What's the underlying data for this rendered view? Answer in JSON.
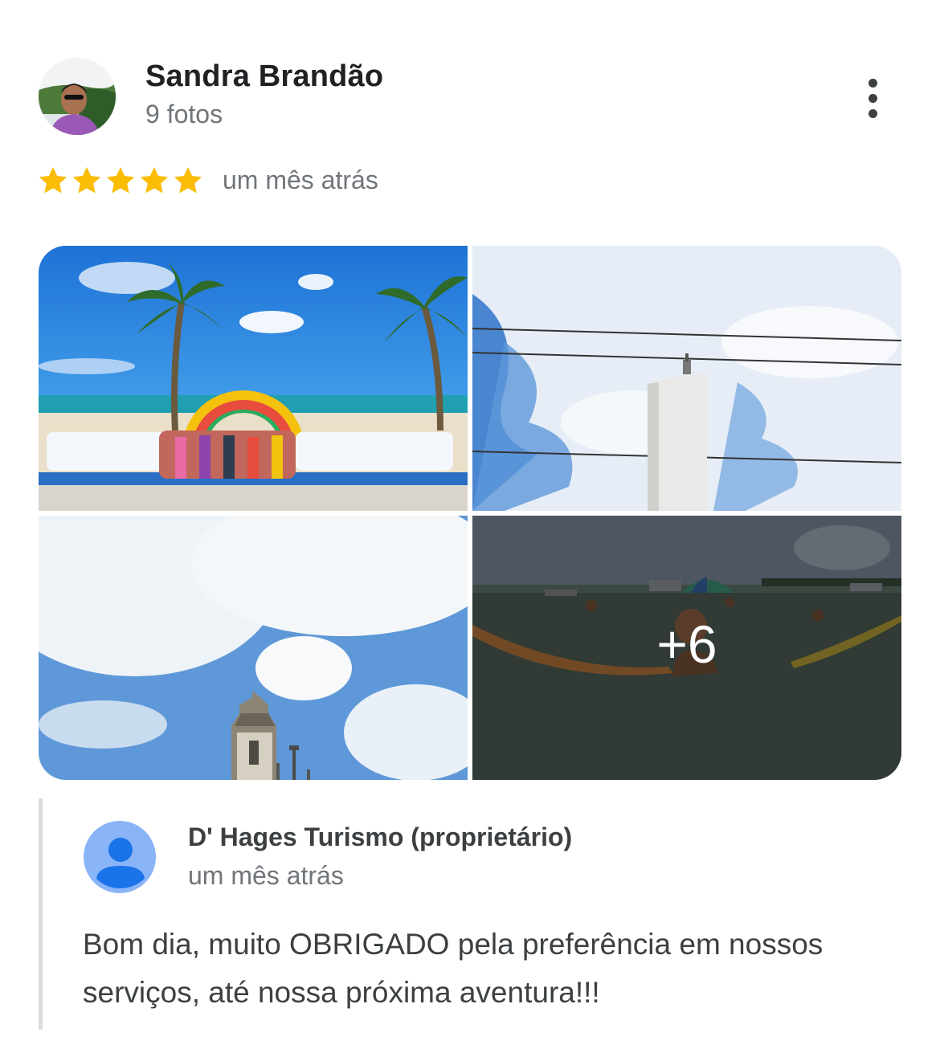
{
  "reviewer": {
    "name": "Sandra Brandão",
    "photo_count": "9 fotos",
    "avatar": "profile-photo"
  },
  "review": {
    "rating": 5,
    "max_rating": 5,
    "star_color": "#fbbc04",
    "time": "um mês atrás"
  },
  "menu": {
    "icon": "more-vertical-icon"
  },
  "photos": {
    "items": [
      {
        "name": "joao-pessoa-sign-beach-photo"
      },
      {
        "name": "lighthouse-sky-photo"
      },
      {
        "name": "church-tower-sky-photo"
      },
      {
        "name": "sea-hammock-photo"
      }
    ],
    "more_label": "+6"
  },
  "owner_reply": {
    "name": "D' Hages Turismo (proprietário)",
    "time": "um mês atrás",
    "avatar_icon": "person-icon",
    "avatar_color": "#8ab4f8",
    "text": "Bom dia, muito OBRIGADO pela preferência em nossos serviços, até nossa próxima aventura!!!"
  }
}
